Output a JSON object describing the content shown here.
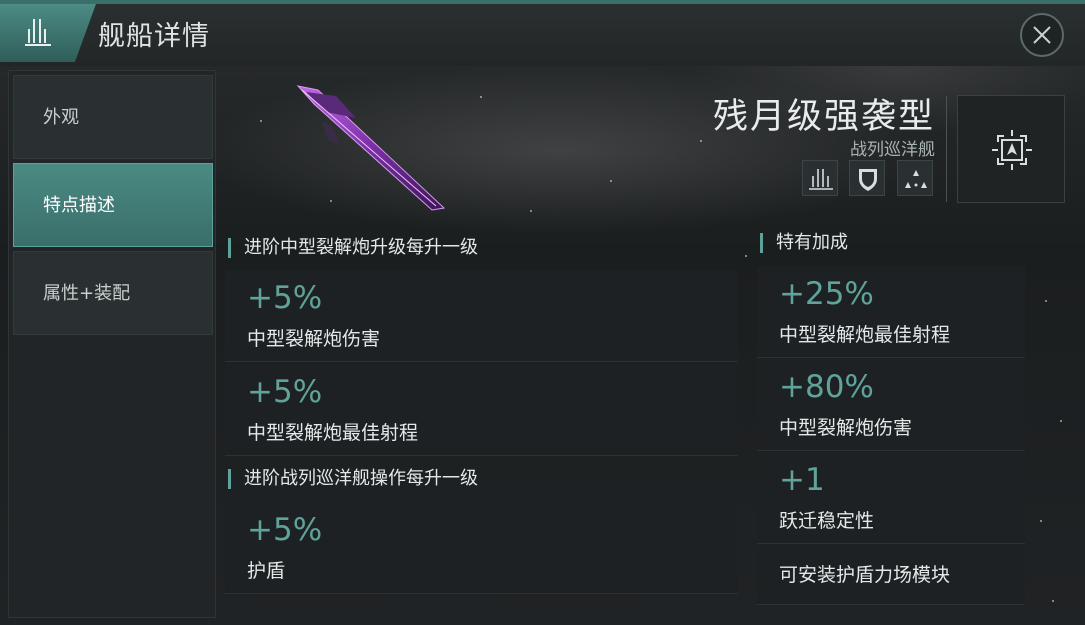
{
  "header": {
    "title": "舰船详情",
    "close_icon": "close-icon",
    "logo_icon": "ship-class-icon"
  },
  "sidebar": {
    "items": [
      {
        "label": "外观",
        "active": false
      },
      {
        "label": "特点描述",
        "active": true
      },
      {
        "label": "属性+装配",
        "active": false
      }
    ]
  },
  "ship": {
    "name": "残月级强袭型",
    "class": "战列巡洋舰",
    "role_icons": [
      "ship-class-icon",
      "shield-icon",
      "fleet-formation-icon"
    ],
    "target_icon": "target-lock-icon"
  },
  "sections": {
    "upgrade_a": {
      "heading": "进阶中型裂解炮升级每升一级",
      "cards": [
        {
          "value": "+5%",
          "label": "中型裂解炮伤害"
        },
        {
          "value": "+5%",
          "label": "中型裂解炮最佳射程"
        }
      ]
    },
    "upgrade_b": {
      "heading": "进阶战列巡洋舰操作每升一级",
      "cards": [
        {
          "value": "+5%",
          "label": "护盾"
        }
      ]
    },
    "bonus": {
      "heading": "特有加成",
      "cards": [
        {
          "value": "+25%",
          "label": "中型裂解炮最佳射程"
        },
        {
          "value": "+80%",
          "label": "中型裂解炮伤害"
        },
        {
          "value": "+1",
          "label": "跃迁稳定性"
        }
      ],
      "note": "可安装护盾力场模块"
    }
  },
  "colors": {
    "accent": "#5ea39b",
    "value_text": "#5fa39a",
    "ship_purple": "#a94fd6"
  }
}
